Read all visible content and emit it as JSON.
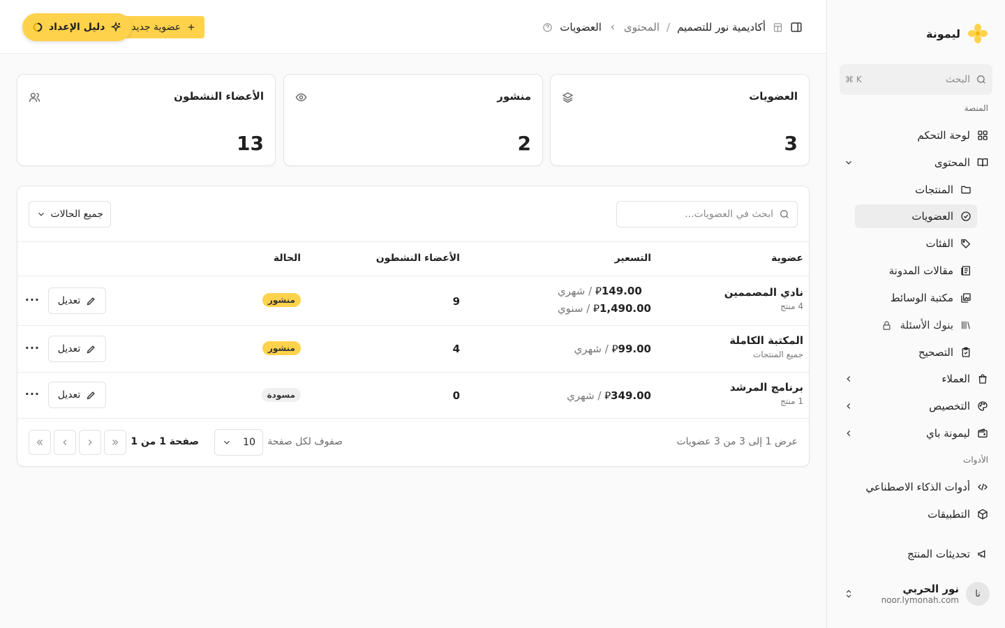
{
  "colors": {
    "accent": "#ffd24c",
    "border": "#e4e4e4",
    "muted": "#777777"
  },
  "sidebar": {
    "brand": "ليمونة",
    "search": {
      "placeholder": "البحث",
      "shortcut": "⌘ K"
    },
    "group_platform": "المنصة",
    "group_tools": "الأدوات",
    "items": [
      {
        "label": "لوحة التحكم",
        "icon": "grid-icon"
      },
      {
        "label": "المحتوى",
        "icon": "book-open-icon"
      },
      {
        "label": "المنتجات",
        "icon": "folder-icon"
      },
      {
        "label": "العضويات",
        "icon": "badge-check-icon"
      },
      {
        "label": "الفئات",
        "icon": "tags-icon"
      },
      {
        "label": "مقالات المدونة",
        "icon": "newspaper-icon"
      },
      {
        "label": "مكتبة الوسائط",
        "icon": "image-library-icon"
      },
      {
        "label": "بنوك الأسئلة",
        "icon": "library-icon"
      },
      {
        "label": "التصحيح",
        "icon": "clipboard-check-icon"
      },
      {
        "label": "العملاء",
        "icon": "shopping-bag-icon"
      },
      {
        "label": "التخصيص",
        "icon": "palette-icon"
      },
      {
        "label": "ليمونة باي",
        "icon": "wallet-icon"
      },
      {
        "label": "أدوات الذكاء الاصطناعي",
        "icon": "code-icon"
      },
      {
        "label": "التطبيقات",
        "icon": "package-icon"
      },
      {
        "label": "تحديثات المنتج",
        "icon": "megaphone-icon"
      }
    ],
    "user": {
      "initials": "نا",
      "name": "نور الحربي",
      "email": "noor.lymonah.com"
    }
  },
  "header": {
    "breadcrumb": {
      "site": "أكاديمية نور للتصميم",
      "section": "المحتوى",
      "current": "العضويات"
    },
    "new_button": "عضوية جديدة",
    "guide_button": "دليل الإعداد"
  },
  "stats": [
    {
      "title": "العضويات",
      "value": "3",
      "icon": "layers-icon"
    },
    {
      "title": "منشور",
      "value": "2",
      "icon": "eye-icon"
    },
    {
      "title": "الأعضاء النشطون",
      "value": "13",
      "icon": "users-icon"
    }
  ],
  "table": {
    "search_placeholder": "ابحث في العضويات...",
    "status_filter": "جميع الحالات",
    "columns": {
      "membership": "عضوية",
      "pricing": "التسعير",
      "active": "الأعضاء النشطون",
      "status": "الحالة"
    },
    "edit_label": "تعديل",
    "more_label": "···",
    "rows": [
      {
        "name": "نادي المصممين",
        "sub": "4 منتج",
        "price1": "149.00",
        "period1": "شهري",
        "price2": "1,490.00",
        "period2": "سنوي",
        "active": "9",
        "status": "منشور"
      },
      {
        "name": "المكتبة الكاملة",
        "sub": "جميع المنتجات",
        "price1": "99.00",
        "period1": "شهري",
        "active": "4",
        "status": "منشور"
      },
      {
        "name": "برنامج المرشد",
        "sub": "1 منتج",
        "price1": "349.00",
        "period1": "شهري",
        "active": "0",
        "status": "مسودة"
      }
    ],
    "currency": "⃁",
    "sep": "/",
    "footer": {
      "info": "عرض 1 إلى 3 من 3 عضويات",
      "rows_per_page_label": "صفوف لكل صفحة",
      "rows_per_page": "10",
      "page": "صفحة 1 من 1"
    }
  }
}
